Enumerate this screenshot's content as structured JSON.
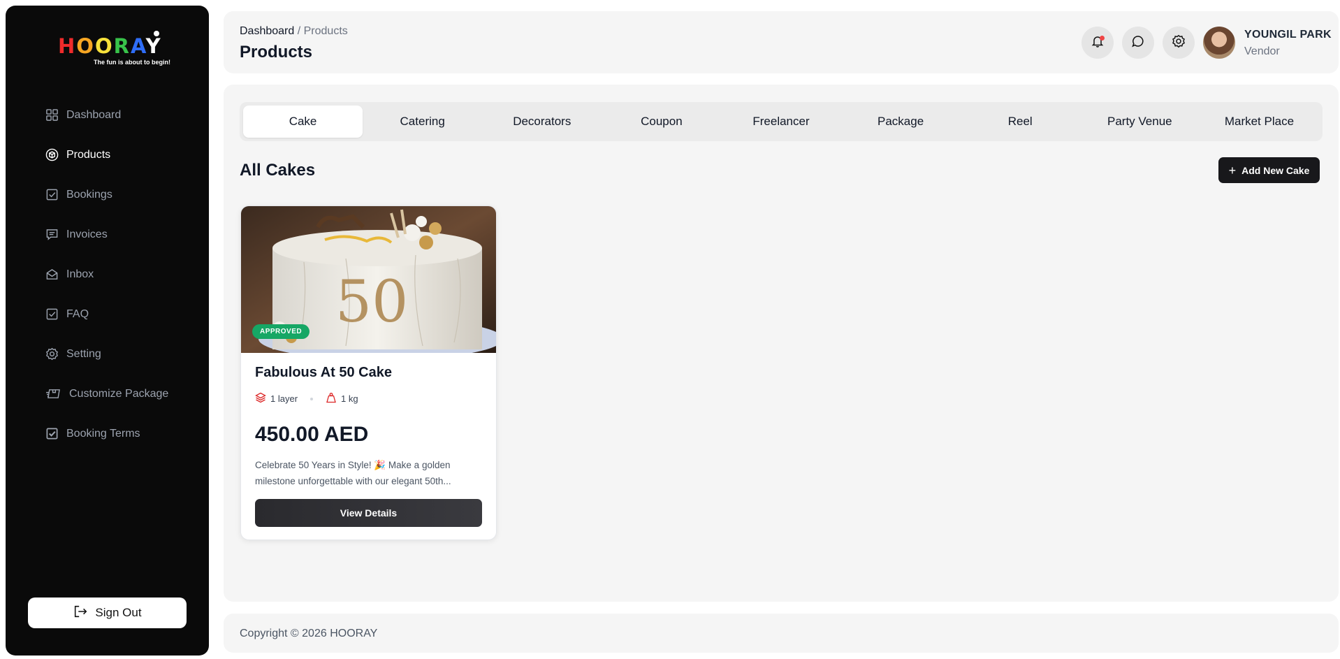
{
  "brand": {
    "logo_letters": [
      "H",
      "O",
      "O",
      "R",
      "A",
      "Y"
    ],
    "tagline": "The fun is about to begin!"
  },
  "sidebar": {
    "items": [
      {
        "label": "Dashboard",
        "icon": "grid-icon"
      },
      {
        "label": "Products",
        "icon": "box-icon",
        "active": true
      },
      {
        "label": "Bookings",
        "icon": "checkbox-icon"
      },
      {
        "label": "Invoices",
        "icon": "invoice-icon"
      },
      {
        "label": "Inbox",
        "icon": "envelope-icon"
      },
      {
        "label": "FAQ",
        "icon": "checkbox-icon"
      },
      {
        "label": "Setting",
        "icon": "gear-icon"
      },
      {
        "label": "Customize Package",
        "icon": "package-icon"
      },
      {
        "label": "Booking Terms",
        "icon": "checkbox-filled-icon"
      }
    ],
    "sign_out": "Sign Out"
  },
  "header": {
    "breadcrumb_home": "Dashboard",
    "breadcrumb_sep": " / ",
    "breadcrumb_current": "Products",
    "title": "Products",
    "user_name": "YOUNGIL PARK",
    "user_role": "Vendor"
  },
  "tabs": [
    {
      "label": "Cake",
      "active": true
    },
    {
      "label": "Catering"
    },
    {
      "label": "Decorators"
    },
    {
      "label": "Coupon"
    },
    {
      "label": "Freelancer"
    },
    {
      "label": "Package"
    },
    {
      "label": "Reel"
    },
    {
      "label": "Party Venue"
    },
    {
      "label": "Market Place"
    }
  ],
  "section": {
    "title": "All Cakes",
    "add_button": "Add New Cake"
  },
  "products": [
    {
      "status": "APPROVED",
      "name": "Fabulous At 50 Cake",
      "layers": "1 layer",
      "weight": "1 kg",
      "price": "450.00 AED",
      "description": "Celebrate 50 Years in Style! 🎉 Make a golden milestone unforgettable with our elegant 50th...",
      "button": "View Details"
    }
  ],
  "footer": {
    "copyright": "Copyright © 2026 HOORAY"
  },
  "colors": {
    "sidebar_bg": "#0a0a0a",
    "approved_badge": "#16a765",
    "notification_dot": "#ef4444",
    "primary_button": "#18181b"
  }
}
